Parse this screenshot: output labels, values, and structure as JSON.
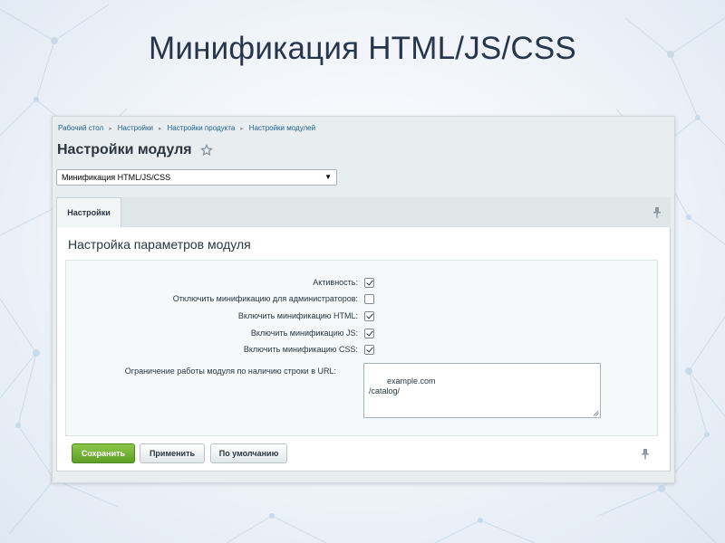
{
  "slide": {
    "title": "Минификация HTML/JS/CSS"
  },
  "breadcrumb": [
    "Рабочий стол",
    "Настройки",
    "Настройки продукта",
    "Настройки модулей"
  ],
  "page": {
    "title": "Настройки модуля",
    "star_icon": "star-icon"
  },
  "module_select": {
    "value": "Минификация HTML/JS/CSS"
  },
  "tabs": [
    {
      "label": "Настройки"
    }
  ],
  "section": {
    "title": "Настройка параметров модуля"
  },
  "options": [
    {
      "label": "Активность:",
      "checked": true
    },
    {
      "label": "Отключить минификацию для администраторов:",
      "checked": false
    },
    {
      "label": "Включить минификацию HTML:",
      "checked": true
    },
    {
      "label": "Включить минификацию JS:",
      "checked": true
    },
    {
      "label": "Включить минификацию CSS:",
      "checked": true
    }
  ],
  "url_restriction": {
    "label": "Ограничение работы модуля по наличию строки в URL:",
    "value": "example.com\n/catalog/"
  },
  "buttons": {
    "save": "Сохранить",
    "apply": "Применить",
    "defaults": "По умолчанию"
  },
  "colors": {
    "save_button": "#6aac2f",
    "link": "#1f5e8a",
    "title": "#27364a"
  }
}
